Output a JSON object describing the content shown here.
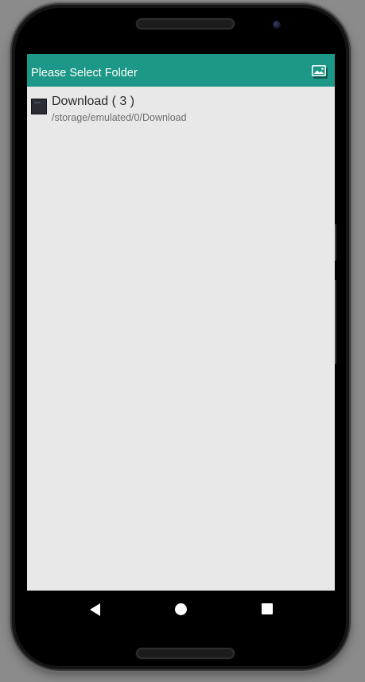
{
  "app_bar": {
    "title": "Please Select Folder",
    "action_icon": "image-gallery-icon",
    "background_color": "#1d9787"
  },
  "folders": [
    {
      "name": "Download ( 3 )",
      "path": "/storage/emulated/0/Download",
      "thumbnail_icon": "folder-thumbnail"
    }
  ],
  "navigation_bar": {
    "back_icon": "back-triangle-icon",
    "home_icon": "home-circle-icon",
    "recents_icon": "recents-square-icon"
  },
  "colors": {
    "screen_background": "#e8e8e8",
    "accent": "#1d9787"
  }
}
